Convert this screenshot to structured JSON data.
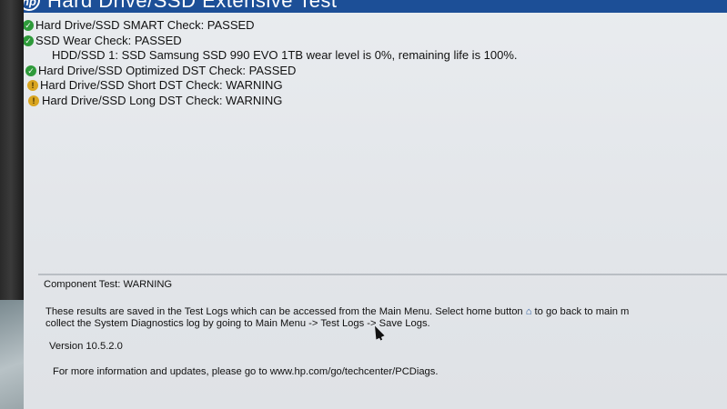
{
  "window": {
    "title": "Hard Drive/SSD Extensive Test"
  },
  "results": [
    {
      "status": "pass",
      "text": "Hard Drive/SSD SMART Check: PASSED"
    },
    {
      "status": "pass",
      "text": "SSD Wear Check: PASSED"
    },
    {
      "status": "none",
      "text": "HDD/SSD 1: SSD Samsung SSD 990 EVO 1TB wear level is 0%, remaining life is 100%."
    },
    {
      "status": "pass",
      "text": "Hard Drive/SSD Optimized DST Check: PASSED"
    },
    {
      "status": "warn",
      "text": "Hard Drive/SSD Short DST Check: WARNING"
    },
    {
      "status": "warn",
      "text": "Hard Drive/SSD Long DST Check: WARNING"
    }
  ],
  "footer": {
    "component_status": "Component Test: WARNING",
    "info_line1_part1": "These results are saved in the Test Logs which can be accessed from the Main Menu. Select home button",
    "info_line1_part2": "to go back to main m",
    "info_line2": "collect the System Diagnostics log by going to Main Menu -> Test Logs -> Save Logs.",
    "version": "Version 10.5.2.0",
    "more_info": "For more information and updates, please go to www.hp.com/go/techcenter/PCDiags."
  },
  "icons": {
    "pass": "check-circle-icon",
    "warn": "warning-circle-icon",
    "home": "home-icon",
    "brand": "hp-logo-icon"
  },
  "colors": {
    "titlebar": "#1c4f97",
    "pass": "#2e9a3a",
    "warn": "#d9a520",
    "home_icon": "#1c4f97"
  }
}
